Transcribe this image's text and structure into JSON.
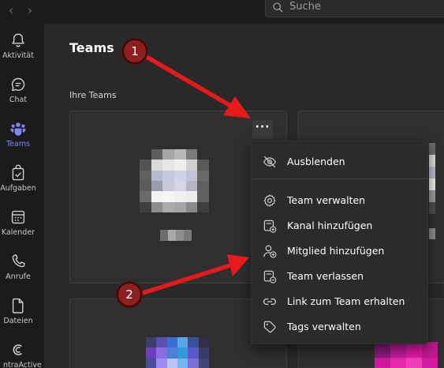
{
  "search": {
    "placeholder": "Suche"
  },
  "rail": {
    "items": [
      {
        "label": "Aktivität",
        "icon": "bell-icon"
      },
      {
        "label": "Chat",
        "icon": "chat-icon"
      },
      {
        "label": "Teams",
        "icon": "teams-icon"
      },
      {
        "label": "Aufgaben",
        "icon": "tasks-icon"
      },
      {
        "label": "Kalender",
        "icon": "calendar-icon"
      },
      {
        "label": "Anrufe",
        "icon": "phone-icon"
      },
      {
        "label": "Dateien",
        "icon": "file-icon"
      },
      {
        "label": "ntraActive ...",
        "icon": "app-icon"
      }
    ],
    "active": "Teams"
  },
  "main": {
    "title": "Teams",
    "section_label": "Ihre Teams"
  },
  "menu": {
    "items": [
      {
        "label": "Ausblenden",
        "icon": "eye-off-icon"
      },
      {
        "label": "Team verwalten",
        "icon": "gear-icon"
      },
      {
        "label": "Kanal hinzufügen",
        "icon": "add-channel-icon"
      },
      {
        "label": "Mitglied hinzufügen",
        "icon": "add-person-icon"
      },
      {
        "label": "Team verlassen",
        "icon": "leave-team-icon"
      },
      {
        "label": "Link zum Team erhalten",
        "icon": "link-icon"
      },
      {
        "label": "Tags verwalten",
        "icon": "tag-icon"
      }
    ]
  },
  "annotations": {
    "callout_1": "1",
    "callout_2": "2"
  },
  "colors": {
    "accent": "#7f85f5",
    "annotation_red": "#e8191a",
    "callout_fill": "#8d1f1f",
    "background": "#292929",
    "menu_background": "#2b2b2b"
  }
}
